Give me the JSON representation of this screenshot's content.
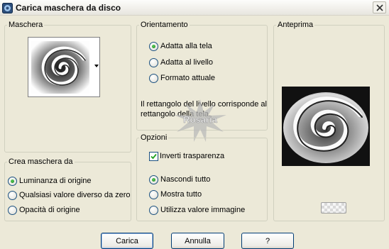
{
  "window": {
    "title": "Carica maschera da disco"
  },
  "mask_group": {
    "label": "Maschera"
  },
  "orientation_group": {
    "label": "Orientamento",
    "options": [
      "Adatta alla tela",
      "Adatta al livello",
      "Formato attuale"
    ],
    "selected": "Adatta alla tela",
    "description": "Il rettangolo del livello corrisponde al rettangolo della tela."
  },
  "preview_group": {
    "label": "Anteprima"
  },
  "create_group": {
    "label": "Crea maschera da",
    "options": [
      "Luminanza di origine",
      "Qualsiasi valore diverso da zero",
      "Opacità di origine"
    ],
    "selected": "Luminanza di origine"
  },
  "options_group": {
    "label": "Opzioni",
    "invert_label": "Inverti trasparenza",
    "invert_checked": true,
    "options": [
      "Nascondi tutto",
      "Mostra tutto",
      "Utilizza valore immagine"
    ],
    "selected": "Nascondi tutto"
  },
  "watermark": {
    "text": "Rosaria"
  },
  "buttons": {
    "load": "Carica",
    "cancel": "Annulla",
    "help": "?"
  },
  "icons": {
    "app": "mask-app-icon",
    "close": "close-icon",
    "dropdown": "chevron-down-icon",
    "checkerboard": "checkerboard-icon"
  },
  "colors": {
    "dialog_bg": "#ece9d8",
    "radio_dot": "#1e7e1e",
    "default_button_border": "#003c74"
  }
}
